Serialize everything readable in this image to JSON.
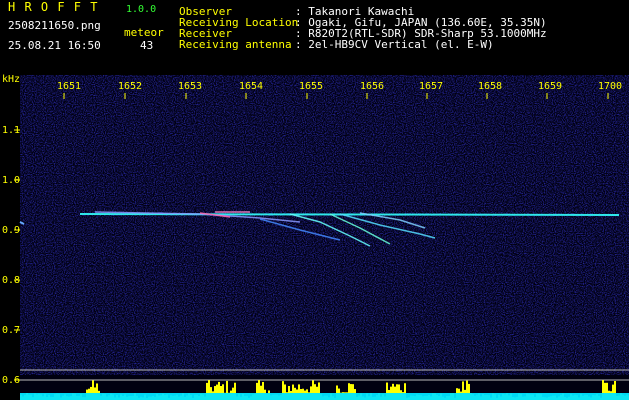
{
  "app": {
    "name": "H R O F F T",
    "version": "1.0.0"
  },
  "file": {
    "name": "2508211650.png",
    "datetime": "25.08.21 16:50"
  },
  "detection": {
    "label": "meteor",
    "count": "43"
  },
  "info": [
    {
      "key": "Observer",
      "value": ": Takanori Kawachi"
    },
    {
      "key": "Receiving Location",
      "value": ": Ogaki, Gifu, JAPAN (136.60E, 35.35N)"
    },
    {
      "key": "Receiver",
      "value": ": R820T2(RTL-SDR) SDR-Sharp 53.1000MHz"
    },
    {
      "key": "Receiving antenna",
      "value": ": 2el-HB9CV Vertical (el. E-W)"
    }
  ],
  "axes": {
    "y_unit": "kHz",
    "y_ticks": [
      "1.1",
      "1.0",
      "0.9",
      "0.8",
      "0.7",
      "0.6"
    ],
    "x_ticks": [
      "1651",
      "1652",
      "1653",
      "1654",
      "1655",
      "1656",
      "1657",
      "1658",
      "1659",
      "1700"
    ]
  },
  "colors": {
    "label_yellow": "#ffff00",
    "version_green": "#33ff33",
    "background": "#000000",
    "carrier_cyan": "#33ffff",
    "level_yellow": "#ffff00",
    "level_cyan": "#00e5ff"
  }
}
